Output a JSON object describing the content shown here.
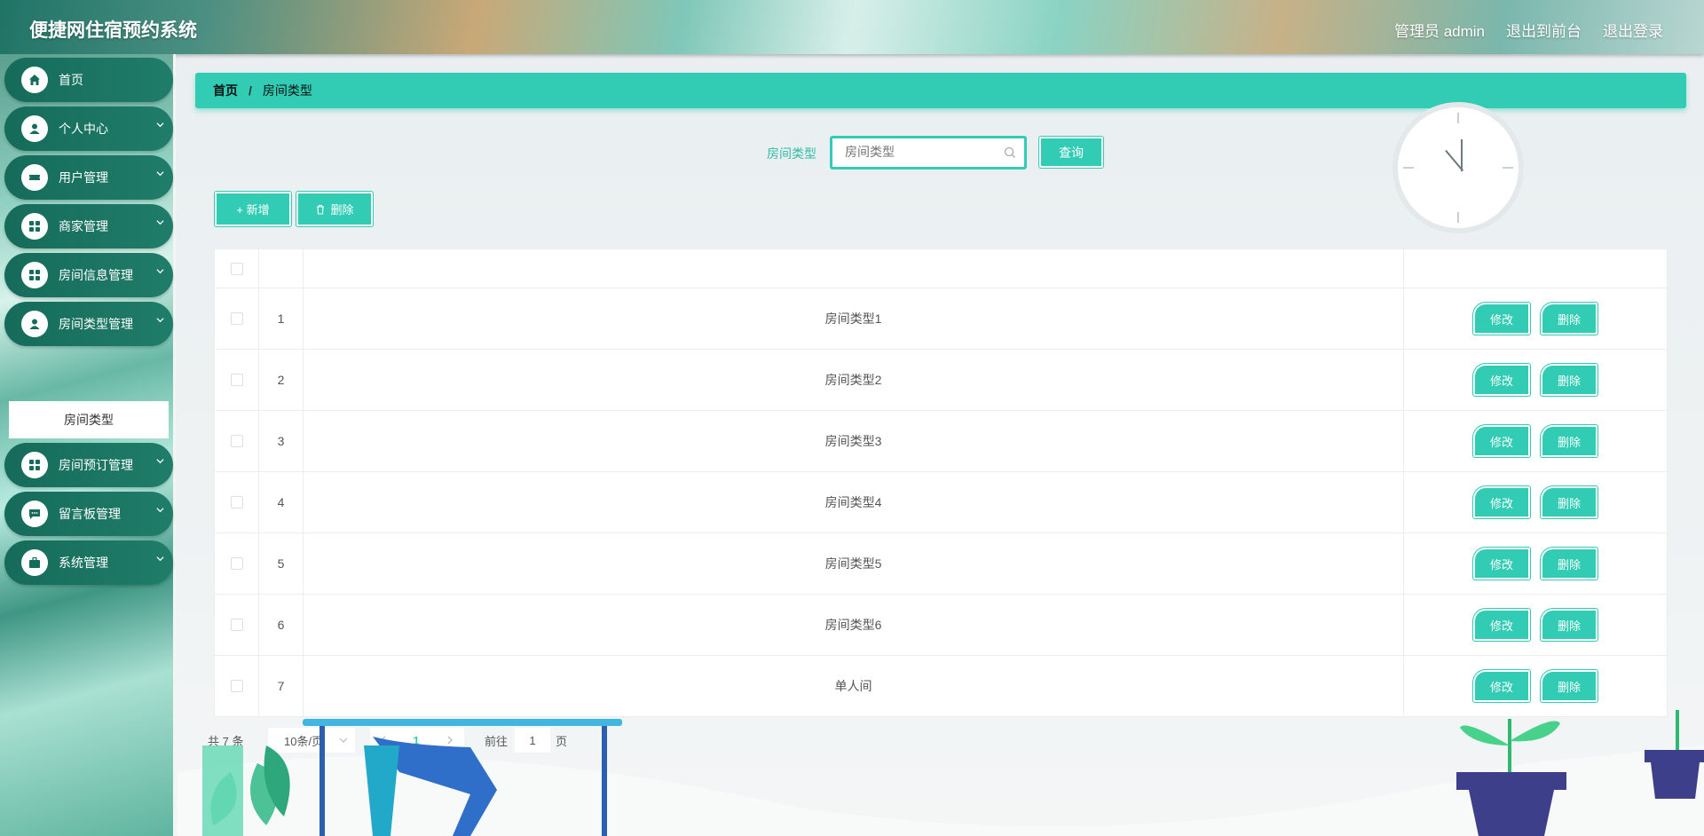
{
  "header": {
    "title": "便捷网住宿预约系统",
    "user": "管理员 admin",
    "to_front": "退出到前台",
    "logout": "退出登录"
  },
  "sidebar": {
    "items": [
      {
        "label": "首页",
        "icon": "home-icon"
      },
      {
        "label": "个人中心",
        "icon": "user-icon"
      },
      {
        "label": "用户管理",
        "icon": "ticket-icon"
      },
      {
        "label": "商家管理",
        "icon": "grid-icon"
      },
      {
        "label": "房间信息管理",
        "icon": "grid-icon"
      },
      {
        "label": "房间类型管理",
        "icon": "user-tie-icon"
      },
      {
        "label": "房间预订管理",
        "icon": "grid-icon"
      },
      {
        "label": "留言板管理",
        "icon": "message-icon"
      },
      {
        "label": "系统管理",
        "icon": "briefcase-icon"
      }
    ],
    "active_sub": "房间类型"
  },
  "breadcrumb": {
    "home": "首页",
    "sep": "/",
    "current": "房间类型"
  },
  "search": {
    "label": "房间类型",
    "placeholder": "房间类型",
    "button": "查询"
  },
  "actions": {
    "add": "+ 新增",
    "delete": "删除"
  },
  "table": {
    "rows": [
      {
        "index": "1",
        "name": "房间类型1"
      },
      {
        "index": "2",
        "name": "房间类型2"
      },
      {
        "index": "3",
        "name": "房间类型3"
      },
      {
        "index": "4",
        "name": "房间类型4"
      },
      {
        "index": "5",
        "name": "房间类型5"
      },
      {
        "index": "6",
        "name": "房间类型6"
      },
      {
        "index": "7",
        "name": "单人间"
      }
    ],
    "edit_label": "修改",
    "delete_label": "删除"
  },
  "pagination": {
    "total": "共 7 条",
    "page_size": "10条/页",
    "current_page": "1",
    "goto_label": "前往",
    "goto_value": "1",
    "page_suffix": "页"
  },
  "colors": {
    "accent": "#32cbb3",
    "nav": "#166b5a"
  }
}
